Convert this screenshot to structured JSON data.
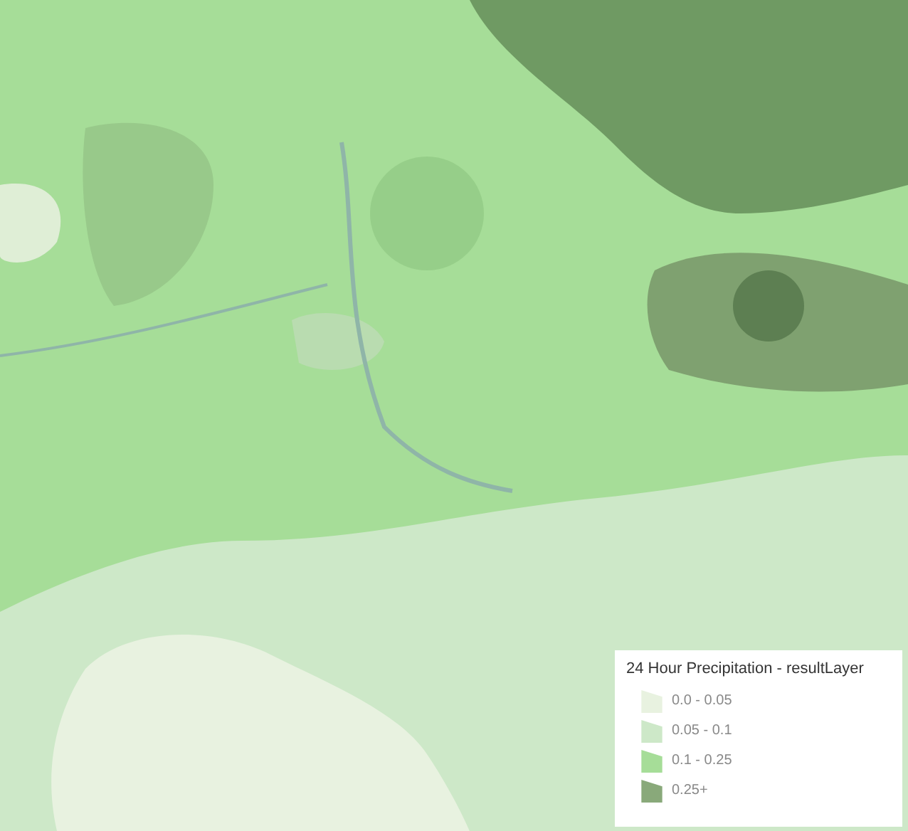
{
  "legend": {
    "title": "24 Hour Precipitation - resultLayer",
    "items": [
      {
        "label": "0.0 - 0.05",
        "color": "#e8f2e0"
      },
      {
        "label": "0.05 - 0.1",
        "color": "#cde8c8"
      },
      {
        "label": "0.1 - 0.25",
        "color": "#a6dd98"
      },
      {
        "label": "0.25+",
        "color": "#89a97a"
      }
    ]
  }
}
